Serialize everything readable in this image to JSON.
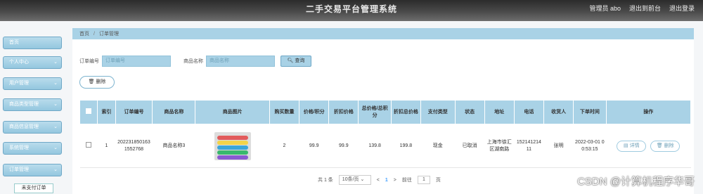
{
  "header": {
    "title": "二手交易平台管理系统",
    "admin_label": "管理员 abo",
    "back_to_front": "退出到前台",
    "logout": "退出登录"
  },
  "sidebar": {
    "items": [
      {
        "label": "首页"
      },
      {
        "label": "个人中心"
      },
      {
        "label": "用户管理"
      },
      {
        "label": "商品类型管理"
      },
      {
        "label": "商品信息管理"
      },
      {
        "label": "系统管理"
      },
      {
        "label": "订单管理"
      }
    ],
    "sub_item": "未支付订单"
  },
  "breadcrumb": {
    "home": "首页",
    "separator": "/",
    "current": "订单管理"
  },
  "search": {
    "field1_label": "订单编号",
    "field1_placeholder": "订单编号",
    "field2_label": "商品名称",
    "field2_placeholder": "商品名称",
    "button": "查询"
  },
  "actions": {
    "delete": "删除"
  },
  "table": {
    "headers": [
      "",
      "索引",
      "订单编号",
      "商品名称",
      "商品图片",
      "购买数量",
      "价格/积分",
      "折扣价格",
      "总价格/总积分",
      "折扣总价格",
      "支付类型",
      "状态",
      "地址",
      "电话",
      "收货人",
      "下单时间",
      "操作"
    ],
    "row": {
      "index": "1",
      "order_no": "2022318501631552768",
      "product_name": "商品名称3",
      "quantity": "2",
      "price": "99.9",
      "discount_price": "99.9",
      "total": "139.8",
      "discount_total": "199.8",
      "pay_type": "现金",
      "status": "已取消",
      "address": "上海市徐汇区湖南路",
      "phone": "15214121411",
      "receiver": "张明",
      "time": "2022-03-01 00:53:15",
      "detail_btn": "详情",
      "delete_btn": "删除"
    }
  },
  "pagination": {
    "total": "共 1 条",
    "page_size": "10条/页",
    "prev": "<",
    "page": "1",
    "next": ">",
    "goto_label": "前往",
    "goto_value": "1",
    "goto_unit": "页"
  },
  "watermark": "CSDN @计算机程序华哥",
  "thumb_colors": [
    "#e25b5b",
    "#f3d34a",
    "#3aa6d9",
    "#39b86d",
    "#8a5ad1"
  ]
}
